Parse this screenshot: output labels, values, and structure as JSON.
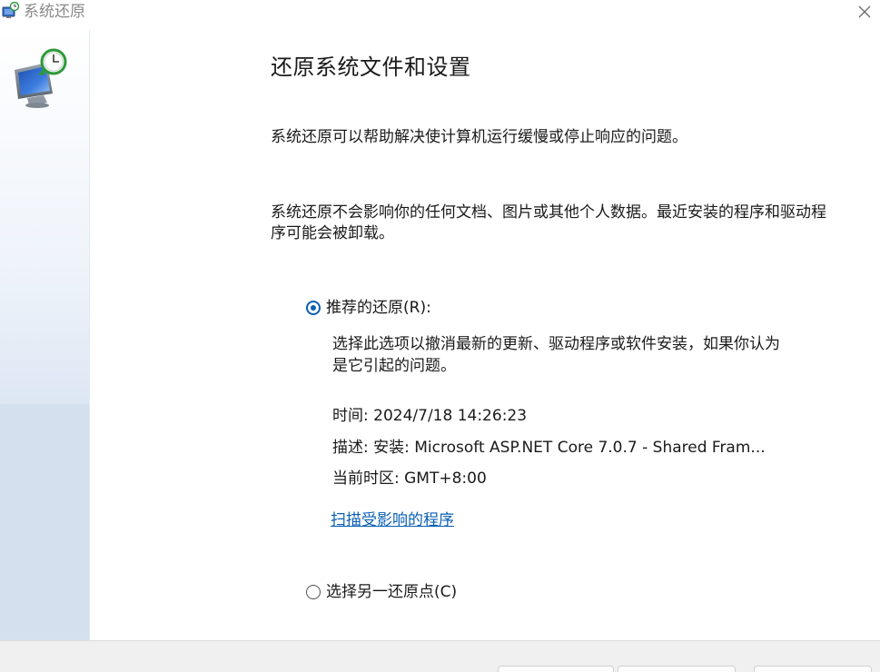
{
  "window": {
    "title": "系统还原"
  },
  "main": {
    "heading": "还原系统文件和设置",
    "paragraph1": "系统还原可以帮助解决使计算机运行缓慢或停止响应的问题。",
    "paragraph2": "系统还原不会影响你的任何文档、图片或其他个人数据。最近安装的程序和驱动程序可能会被卸载。"
  },
  "options": {
    "recommended": {
      "label": "推荐的还原(R):",
      "selected": true,
      "description": "选择此选项以撤消最新的更新、驱动程序或软件安装，如果你认为是它引起的问题。",
      "time": "时间: 2024/7/18 14:26:23",
      "detail": "描述: 安装: Microsoft ASP.NET Core 7.0.7 - Shared Fram...",
      "timezone": "当前时区: GMT+8:00",
      "scan_link": "扫描受影响的程序"
    },
    "other": {
      "label": "选择另一还原点(C)",
      "selected": false
    }
  },
  "colors": {
    "accent": "#0a5fb4",
    "sidebar": "#d5e0ef",
    "footer": "#f0f0f0"
  },
  "icons": {
    "title": "system-restore-icon",
    "close": "close-icon",
    "sidebar": "system-restore-monitor-clock-icon"
  }
}
